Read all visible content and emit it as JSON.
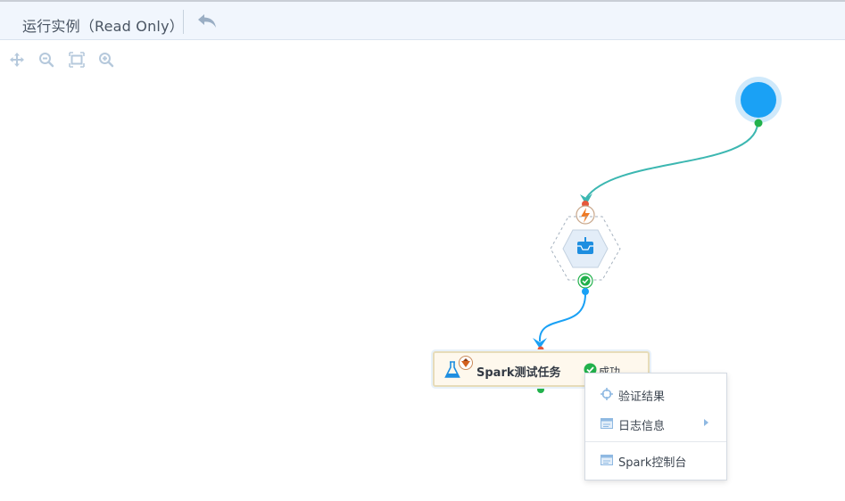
{
  "header": {
    "title": "运行实例（Read Only）",
    "undo_icon": "undo-arrow-icon"
  },
  "toolbar": {
    "icons": [
      "move-icon",
      "zoom-out-icon",
      "fit-view-icon",
      "zoom-in-icon"
    ]
  },
  "flow": {
    "start_node_icon": "start-circle-icon",
    "trigger_node_icon": "lightning-icon",
    "inbox_node_icon": "inbox-download-icon",
    "inbox_node_status_icon": "check-circle-icon",
    "task_node": {
      "name": "Spark测试任务",
      "status": "成功",
      "type_icon": "flask-icon",
      "badge_icon": "spark-icon",
      "status_icon": "check-circle-icon"
    }
  },
  "context_menu": {
    "items": [
      {
        "label": "验证结果",
        "icon": "crosshair-icon",
        "has_submenu": false
      },
      {
        "label": "日志信息",
        "icon": "log-window-icon",
        "has_submenu": true
      },
      {
        "label": "Spark控制台",
        "icon": "console-window-icon",
        "has_submenu": false
      }
    ]
  },
  "colors": {
    "accent": "#1aa1f5",
    "edge": "#3cb7b1",
    "success": "#22b14c",
    "error_port": "#e5583b"
  }
}
